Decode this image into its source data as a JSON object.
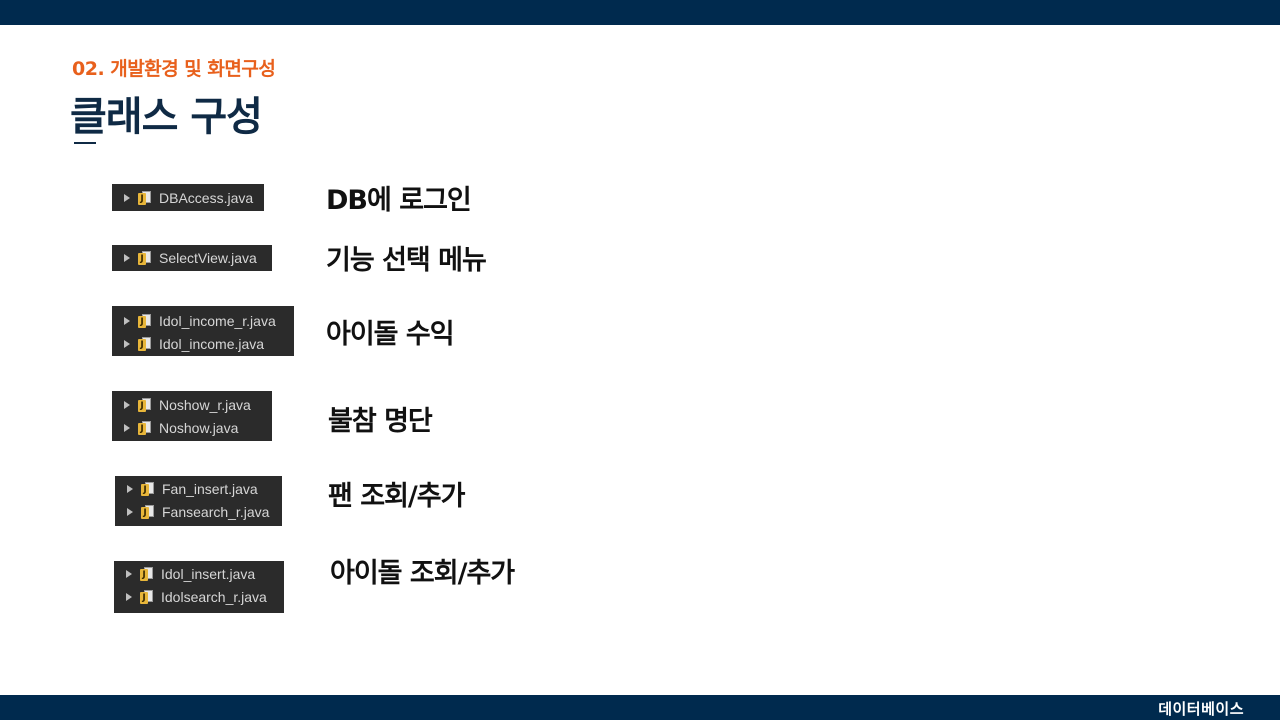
{
  "header": {
    "section_label": "02. 개발환경 및 화면구성",
    "title": "클래스 구성"
  },
  "footer": {
    "label": "데이터베이스"
  },
  "groups": [
    {
      "files": [
        "DBAccess.java"
      ],
      "description": "DB에 로그인"
    },
    {
      "files": [
        "SelectView.java"
      ],
      "description": "기능 선택 메뉴"
    },
    {
      "files": [
        "Idol_income_r.java",
        "Idol_income.java"
      ],
      "description": "아이돌 수익"
    },
    {
      "files": [
        "Noshow_r.java",
        "Noshow.java"
      ],
      "description": "불참 명단"
    },
    {
      "files": [
        "Fan_insert.java",
        "Fansearch_r.java"
      ],
      "description": "팬 조회/추가"
    },
    {
      "files": [
        "Idol_insert.java",
        "Idolsearch_r.java"
      ],
      "description": "아이돌 조회/추가"
    }
  ],
  "colors": {
    "bar": "#002a4e",
    "accent": "#e8601c",
    "title": "#0f2a45",
    "panel": "#2b2b2b"
  },
  "icons": {
    "expand": "expand-arrow-icon",
    "file": "java-file-icon"
  }
}
